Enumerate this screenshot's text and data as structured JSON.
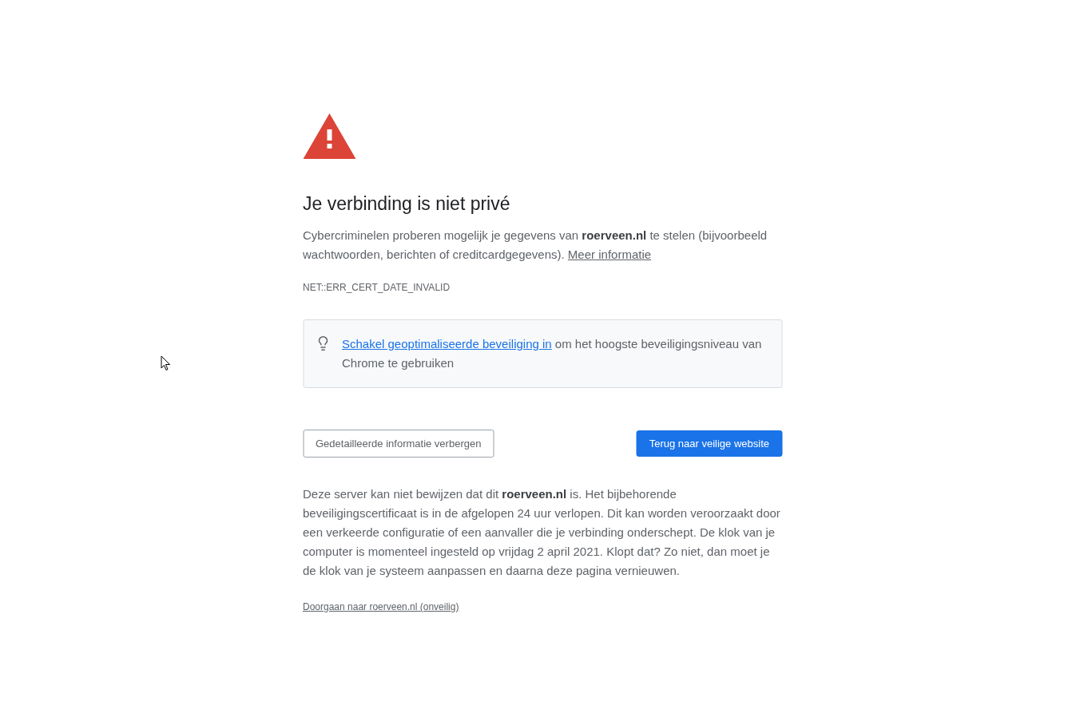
{
  "heading": "Je verbinding is niet privé",
  "intro": {
    "text": "Cybercriminelen proberen mogelijk je gegevens van **roerveen.nl** te stelen (bijvoorbeeld wachtwoorden, berichten of creditcardgegevens).",
    "link": "Meer informatie"
  },
  "error_code": "NET::ERR_CERT_DATE_INVALID",
  "tip": {
    "link": "Schakel geoptimaliseerde beveiliging in",
    "text": "om het hoogste beveiligingsniveau van Chrome te gebruiken"
  },
  "buttons": [
    {
      "label": "Gedetailleerde informatie verbergen",
      "kind": "secondary"
    },
    {
      "label": "Terug naar veilige website",
      "kind": "primary"
    }
  ],
  "details": "Deze server kan niet bewijzen dat dit **roerveen.nl** is. Het bijbehorende beveiligingscertificaat is in de afgelopen 24 uur verlopen. Dit kan worden veroorzaakt door een verkeerde configuratie of een aanvaller die je verbinding onderschept. De klok van je computer is momenteel ingesteld op vrijdag 2 april 2021. Klopt dat? Zo niet, dan moet je de klok van je systeem aanpassen en daarna deze pagina vernieuwen.",
  "proceed_link": "Doorgaan naar roerveen.nl (onveilig)"
}
